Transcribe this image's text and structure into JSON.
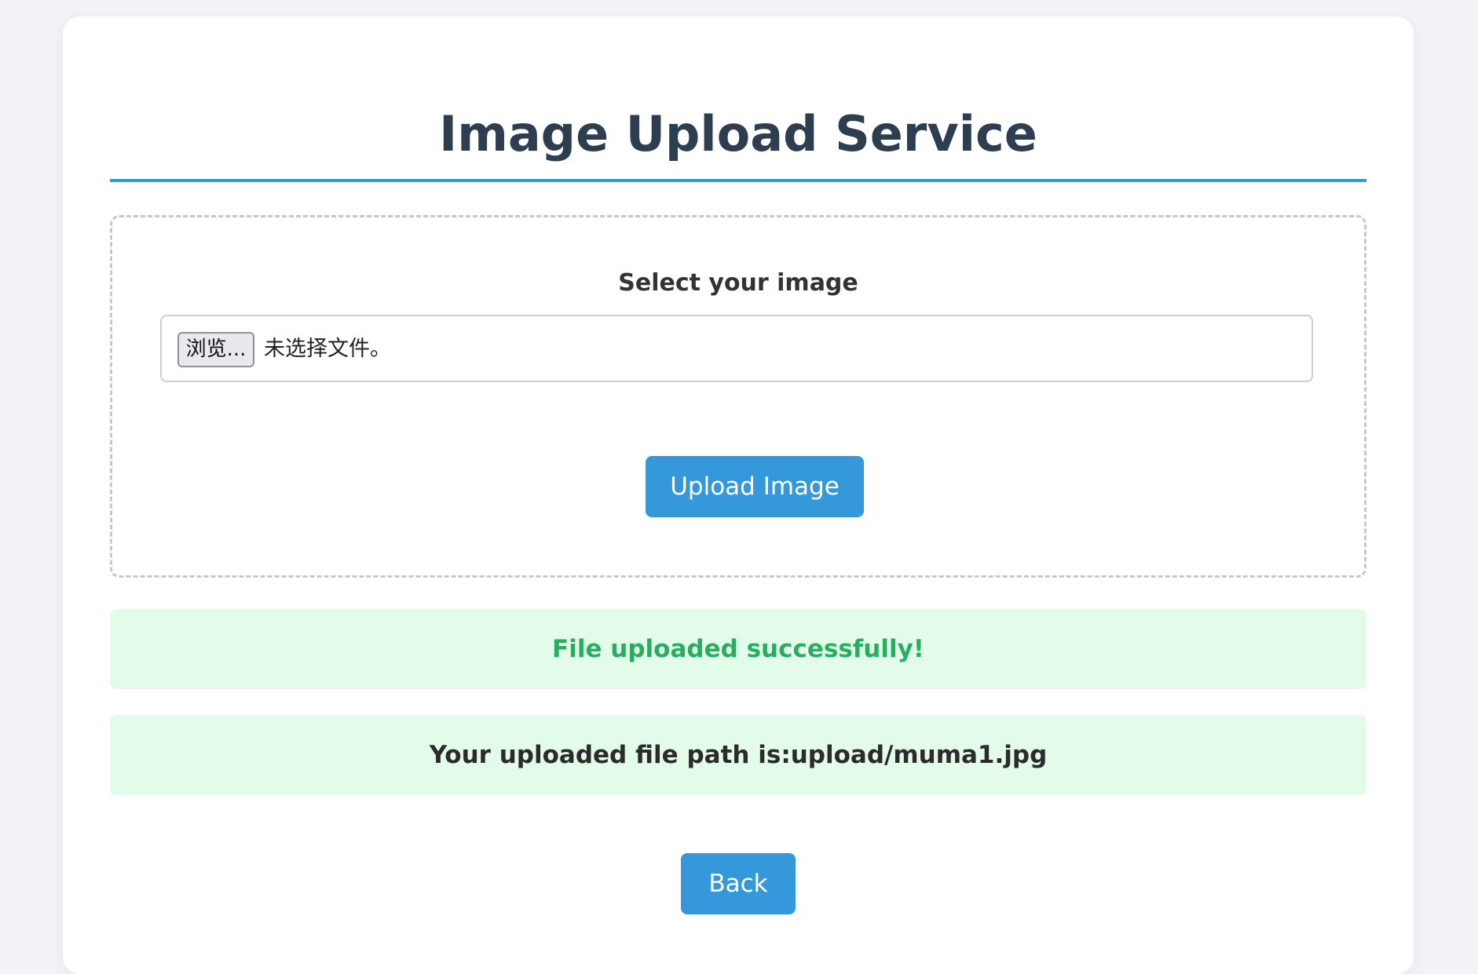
{
  "page": {
    "title": "Image Upload Service"
  },
  "upload_form": {
    "select_label": "Select your image",
    "browse_label": "浏览...",
    "no_file_text": "未选择文件。",
    "upload_label": "Upload Image"
  },
  "messages": {
    "success": "File uploaded successfully!",
    "path": "Your uploaded file path is:upload/muma1.jpg"
  },
  "navigation": {
    "back_label": "Back"
  },
  "colors": {
    "accent": "#3498db",
    "title": "#2c3e50",
    "success_text": "#27ae60",
    "message_background": "#e3fcea",
    "page_background": "#f3f3f7"
  }
}
